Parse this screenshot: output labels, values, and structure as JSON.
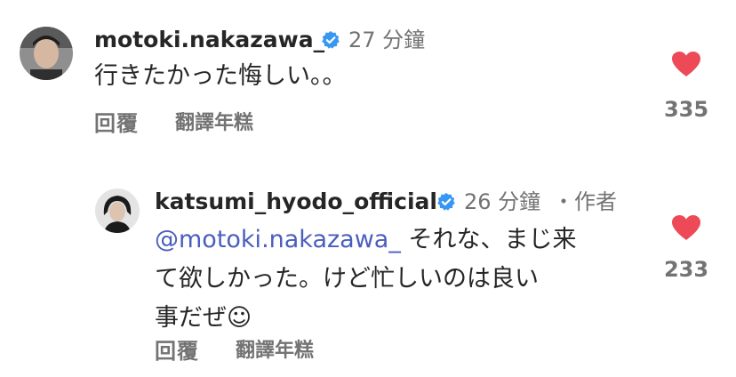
{
  "comments": [
    {
      "username": "motoki.nakazawa_",
      "verified": true,
      "time": "27 分鐘",
      "text": "行きたかった悔しい。。",
      "reply_label": "回覆",
      "translate_label": "翻譯年糕",
      "likes": "335"
    },
    {
      "username": "katsumi_hyodo_official",
      "verified": true,
      "time": "26 分鐘",
      "author_tag": "・作者",
      "mention": "@motoki.nakazawa_",
      "text_line1": " それな、まじ来",
      "text_line2": "て欲しかった。けど忙しいのは良い",
      "text_line3": "事だぜ☺",
      "reply_label": "回覆",
      "translate_label": "翻譯年糕",
      "likes": "233"
    }
  ],
  "colors": {
    "heart": "#ed4956",
    "verified": "#3897f0",
    "mention": "#4a5ebd",
    "secondary": "#737373"
  }
}
